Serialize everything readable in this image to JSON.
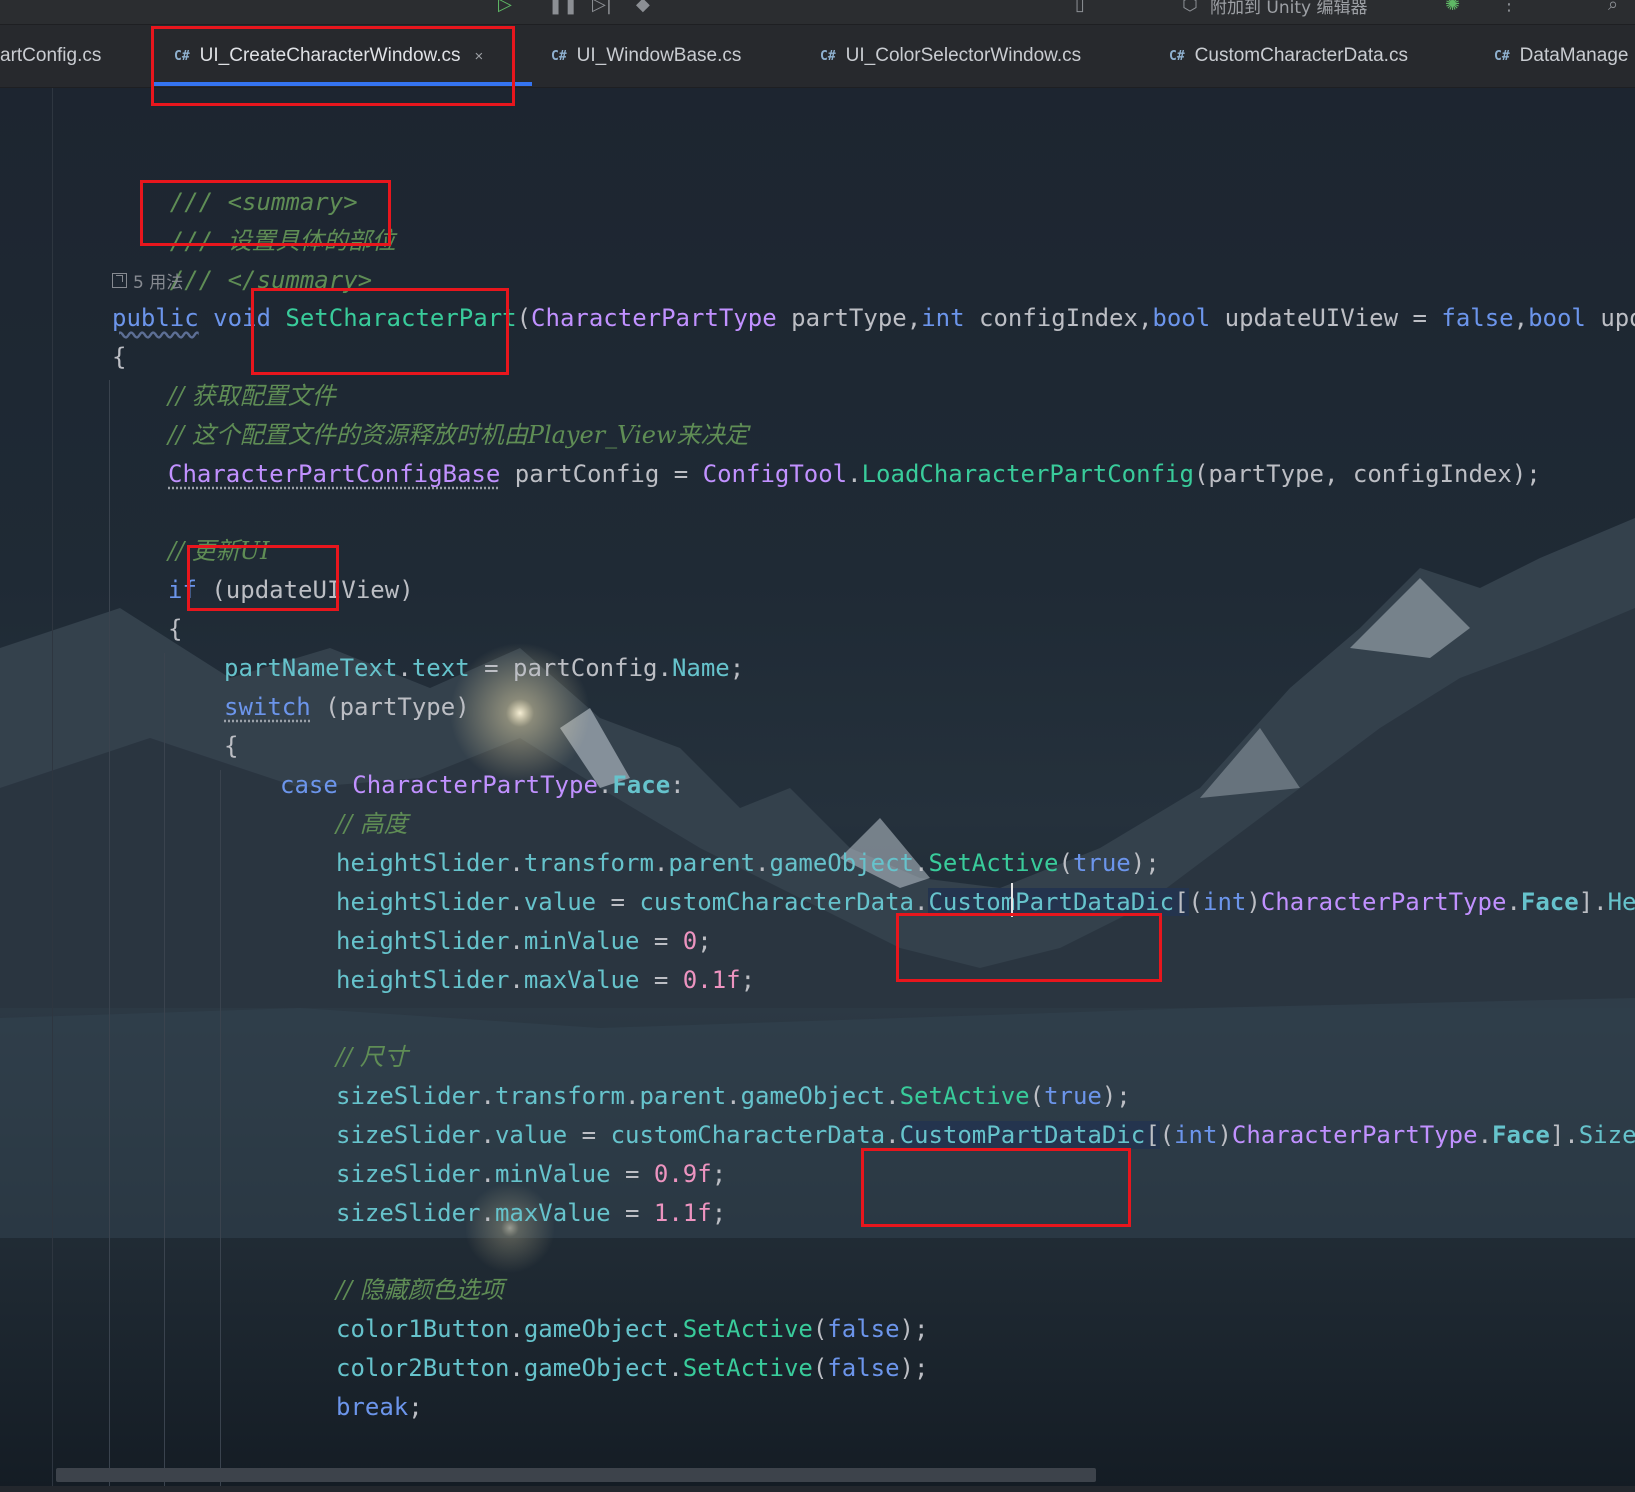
{
  "toolbar": {
    "run_icon": "play-icon",
    "debug_icon": "debug-icon",
    "attach_text": "附加到 Unity 编辑器"
  },
  "tabs": [
    {
      "label": "artConfig.cs",
      "lang": ""
    },
    {
      "label": "UI_CreateCharacterWindow.cs",
      "lang": "C#",
      "active": true
    },
    {
      "label": "UI_WindowBase.cs",
      "lang": "C#"
    },
    {
      "label": "UI_ColorSelectorWindow.cs",
      "lang": "C#"
    },
    {
      "label": "CustomCharacterData.cs",
      "lang": "C#"
    },
    {
      "label": "DataManage",
      "lang": "C#"
    }
  ],
  "tab_close": "×",
  "editor": {
    "usages": "5 用法",
    "code": {
      "l1_doc": "/// <summary>",
      "l2_slashes": "/// ",
      "l2_text": "设置具体的部位",
      "l3_doc": "/// </summary>",
      "l4": {
        "public": "public",
        "void": "void",
        "name": "SetCharacterPart",
        "paren": "(",
        "type1": "CharacterPartType",
        "p1": " partType,",
        "int": "int",
        "p2": " configIndex,",
        "bool1": "bool",
        "p3": " updateUIView = ",
        "false": "false",
        "comma": ",",
        "bool2": "bool",
        "p4": " update"
      },
      "l5": "{",
      "l6": "// 获取配置文件",
      "l7": "// 这个配置文件的资源释放时机由Player_View来决定",
      "l8": {
        "type": "CharacterPartConfigBase",
        "var": " partConfig = ",
        "tool": "ConfigTool",
        "dot": ".",
        "method": "LoadCharacterPartConfig",
        "args": "(partType, configIndex);"
      },
      "l9": "// 更新UI",
      "l10": {
        "if": "if",
        "rest": " (updateUIView)"
      },
      "l11": "{",
      "l12": {
        "field": "partNameText",
        "dot1": ".",
        "prop": "text",
        "mid": " = partConfig.",
        "prop2": "Name",
        "end": ";"
      },
      "l13": {
        "switch": "switch",
        "rest": " (partType)"
      },
      "l14": "{",
      "l15": {
        "case": "case",
        "sp": " ",
        "type": "CharacterPartType",
        "dot": ".",
        "member": "Face",
        "colon": ":"
      },
      "l16": "// 高度",
      "l17": {
        "field": "heightSlider",
        "d1": ".",
        "p1": "transform",
        "d2": ".",
        "p2": "parent",
        "d3": ".",
        "p3": "gameObject",
        "d4": ".",
        "method": "SetActive",
        "open": "(",
        "true": "true",
        "close": ");"
      },
      "l18": {
        "field": "heightSlider",
        "d1": ".",
        "p1": "value",
        "eq": " = ",
        "f2": "customCharacterData",
        "d2": ".",
        "dic": "CustomPartDataDic",
        "br": "[",
        "cast_open": "(",
        "int": "int",
        "cast_close": ")",
        "type": "CharacterPartType",
        "d3": ".",
        "member": "Face",
        "br2": "].",
        "prop": "Heigh"
      },
      "l19": {
        "field": "heightSlider",
        "d1": ".",
        "prop": "minValue",
        "eq": " = ",
        "num": "0",
        "end": ";"
      },
      "l20": {
        "field": "heightSlider",
        "d1": ".",
        "prop": "maxValue",
        "eq": " = ",
        "num": "0.1f",
        "end": ";"
      },
      "l21": "// 尺寸",
      "l22": {
        "field": "sizeSlider",
        "d1": ".",
        "p1": "transform",
        "d2": ".",
        "p2": "parent",
        "d3": ".",
        "p3": "gameObject",
        "d4": ".",
        "method": "SetActive",
        "open": "(",
        "true": "true",
        "close": ");"
      },
      "l23": {
        "field": "sizeSlider",
        "d1": ".",
        "p1": "value",
        "eq": " = ",
        "f2": "customCharacterData",
        "d2": ".",
        "dic": "CustomPartDataDic",
        "br": "[",
        "cast_open": "(",
        "int": "int",
        "cast_close": ")",
        "type": "CharacterPartType",
        "d3": ".",
        "member": "Face",
        "br2": "].",
        "prop": "Size",
        "end": ";"
      },
      "l24": {
        "field": "sizeSlider",
        "d1": ".",
        "prop": "minValue",
        "eq": " = ",
        "num": "0.9f",
        "end": ";"
      },
      "l25": {
        "field": "sizeSlider",
        "d1": ".",
        "prop": "maxValue",
        "eq": " = ",
        "num": "1.1f",
        "end": ";"
      },
      "l26": "// 隐藏颜色选项",
      "l27": {
        "field": "color1Button",
        "d1": ".",
        "p1": "gameObject",
        "d2": ".",
        "method": "SetActive",
        "open": "(",
        "false": "false",
        "close": ");"
      },
      "l28": {
        "field": "color2Button",
        "d1": ".",
        "p1": "gameObject",
        "d2": ".",
        "method": "SetActive",
        "open": "(",
        "false": "false",
        "close": ");"
      },
      "l29": {
        "break": "break",
        "end": ";"
      }
    }
  },
  "colors": {
    "annotation_box": "#e8161d",
    "tab_underline": "#3574f0",
    "keyword": "#6c95eb",
    "comment": "#5f8d55"
  }
}
